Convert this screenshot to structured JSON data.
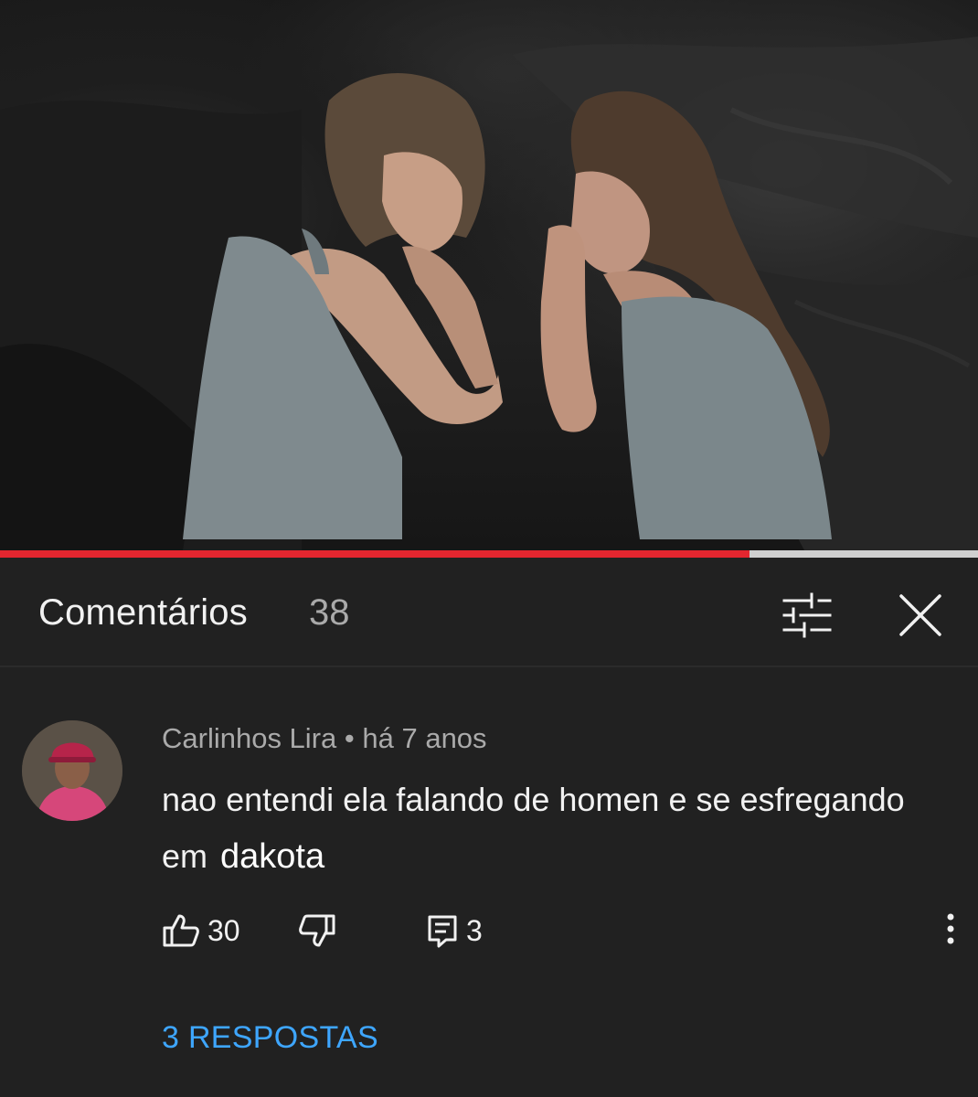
{
  "video": {
    "progress_fraction": 0.766
  },
  "comments_panel": {
    "title": "Comentários",
    "count": "38",
    "filter_icon": "sliders-icon",
    "close_icon": "close-icon"
  },
  "comment": {
    "author": "Carlinhos Lira",
    "separator": "•",
    "time": "há 7 anos",
    "text": "nao entendi ela falando de homen e se esfregando em",
    "overlay_text": "dakota",
    "likes": "30",
    "like_icon": "thumbs-up-icon",
    "dislike_icon": "thumbs-down-icon",
    "reply_icon": "reply-icon",
    "reply_count": "3",
    "more_icon": "more-vertical-icon",
    "replies_label": "3 RESPOSTAS"
  },
  "colors": {
    "background": "#212121",
    "progress_red": "#e3262f",
    "link_blue": "#3ea6ff",
    "muted_text": "#aaaaaa"
  }
}
